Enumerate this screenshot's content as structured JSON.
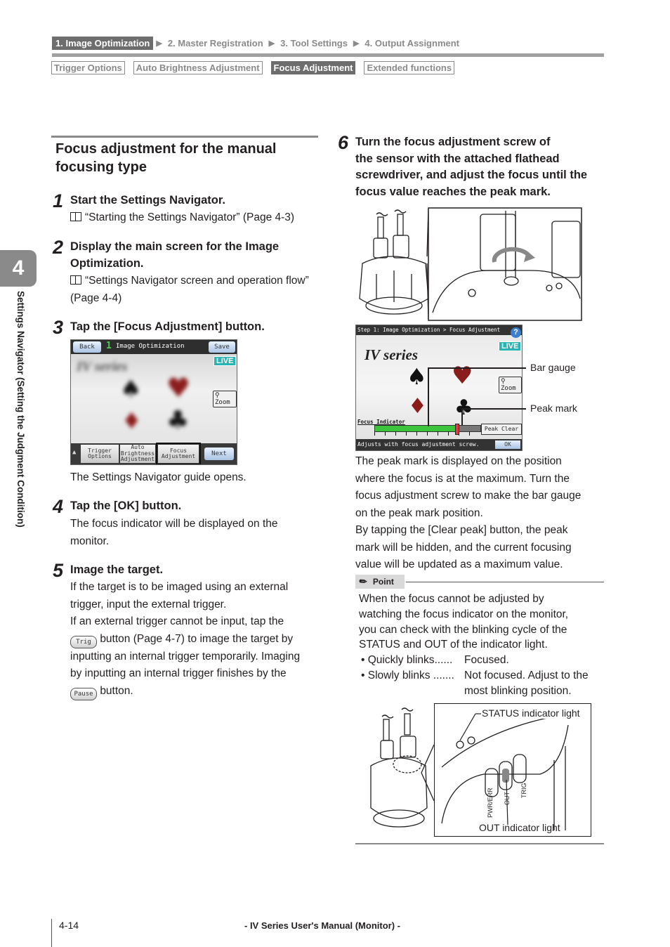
{
  "breadcrumb": {
    "items": [
      "1. Image Optimization",
      "2. Master Registration",
      "3. Tool Settings",
      "4. Output Assignment"
    ],
    "active_index": 0,
    "separator_icon": "triangle-right-icon"
  },
  "subtabs": {
    "items": [
      "Trigger Options",
      "Auto Brightness Adjustment",
      "Focus Adjustment",
      "Extended functions"
    ],
    "active_index": 2
  },
  "chapter": {
    "number": "4",
    "label": "Settings Navigator (Setting the Judgment Condition)"
  },
  "section": {
    "title_line1": "Focus adjustment for the manual",
    "title_line2": "focusing type"
  },
  "steps": [
    {
      "number": "1",
      "title": "Start the Settings Navigator.",
      "ref": "“Starting the Settings Navigator” (Page 4-3)"
    },
    {
      "number": "2",
      "title_line1": "Display the main screen for the Image",
      "title_line2": "Optimization.",
      "ref_line1": "“Settings Navigator screen and operation flow”",
      "ref_line2": "(Page 4-4)"
    },
    {
      "number": "3",
      "title": "Tap the [Focus Adjustment] button.",
      "caption": "The Settings Navigator guide opens.",
      "screen": {
        "back": "Back",
        "step_digit": "1",
        "title": "Image Optimization",
        "save": "Save",
        "live": "LIVE",
        "watermark": "IV series",
        "zoom": "Zoom",
        "tabs": [
          "Trigger Options",
          "Auto Brightness Adjustment",
          "Focus Adjustment"
        ],
        "next": "Next"
      }
    },
    {
      "number": "4",
      "title": "Tap the [OK] button.",
      "body_line1": "The focus indicator will be displayed on the",
      "body_line2": "monitor."
    },
    {
      "number": "5",
      "title": "Image the target.",
      "lines": [
        "If the target is to be imaged using an external",
        "trigger, input the external trigger.",
        "If an external trigger cannot be input, tap the"
      ],
      "trig_button": "Trig",
      "line_trig": "button (Page 4-7) to image the target by",
      "line_after1": "inputting an internal trigger temporarily.  Imaging",
      "line_after2": "by inputting an internal trigger finishes by the",
      "pause_button": "Pause",
      "line_pause": "button."
    },
    {
      "number": "6",
      "title_lines": [
        "Turn the focus adjustment screw of",
        "the sensor with the attached flathead",
        "screwdriver, and adjust the focus until the",
        "focus value reaches the peak mark."
      ],
      "screen": {
        "header": "Step 1: Image Optimization > Focus Adjustment",
        "help_icon": "?",
        "live": "LIVE",
        "watermark": "IV series",
        "zoom": "Zoom",
        "indicator_label": "Focus Indicator",
        "peak_clear": "Peak Clear",
        "status": "Adjusts with focus adjustment screw.",
        "ok": "OK",
        "bar_level": 0.77,
        "peak_level": 0.77
      },
      "callouts": {
        "bar_gauge": "Bar gauge",
        "peak_mark": "Peak mark"
      },
      "body_lines": [
        "The peak mark is displayed on the position",
        "where the focus is at the maximum. Turn the",
        "focus adjustment screw to make the bar gauge",
        "on the peak mark position.",
        "By tapping the [Clear peak] button, the peak",
        "mark will be hidden, and the current focusing",
        "value will be updated as a maximum value."
      ]
    }
  ],
  "point": {
    "label": "Point",
    "icon": "pencil-icon",
    "lines": [
      "When the focus cannot be adjusted by",
      "watching the focus indicator on the monitor,",
      "you can check with the blinking cycle of the",
      "STATUS and OUT of the indicator light."
    ],
    "bullets": [
      {
        "term": "• Quickly blinks......",
        "desc": "Focused."
      },
      {
        "term": "• Slowly blinks .......",
        "desc": "Not focused. Adjust to the",
        "desc2": "most blinking position."
      }
    ]
  },
  "illustration2": {
    "status_label": "STATUS indicator light",
    "out_label": "OUT indicator light",
    "labels": [
      "PWR/ERR",
      "OUT",
      "TRIG"
    ]
  },
  "footer": {
    "page": "4-14",
    "manual": "- IV Series User's Manual (Monitor) -"
  }
}
